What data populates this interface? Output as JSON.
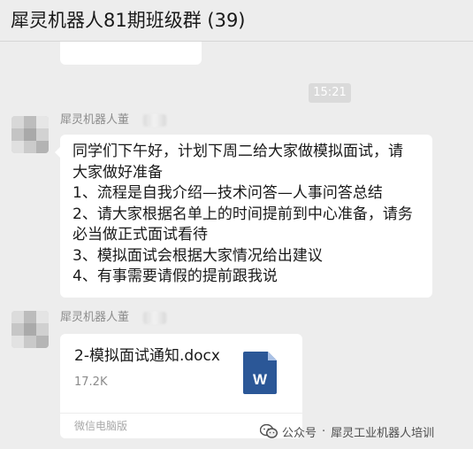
{
  "window": {
    "title": "犀灵机器人81期班级群 (39)"
  },
  "chat": {
    "timestamp": "15:21",
    "messages": [
      {
        "sender": "犀灵机器人董",
        "type": "text",
        "lines": [
          "同学们下午好，计划下周二给大家做模拟面试，请",
          "大家做好准备",
          "1、流程是自我介绍—技术问答—人事问答总结",
          "2、请大家根据名单上的时间提前到中心准备，请务",
          "必当做正式面试看待",
          "3、模拟面试会根据大家情况给出建议",
          "4、有事需要请假的提前跟我说"
        ]
      },
      {
        "sender": "犀灵机器人董",
        "type": "file",
        "file": {
          "name": "2-模拟面试通知.docx",
          "size": "17.2K",
          "icon_letter": "W",
          "source": "微信电脑版"
        }
      }
    ]
  },
  "watermark": {
    "account_type": "公众号",
    "separator": "·",
    "account_name": "犀灵工业机器人培训"
  },
  "colors": {
    "background": "#ededed",
    "bubble": "#ffffff",
    "word_blue": "#2b5797",
    "secondary_text": "#8c8c8c"
  },
  "icons": {
    "file_icon": "word-document-icon",
    "watermark_icon": "wechat-official-account-icon"
  }
}
